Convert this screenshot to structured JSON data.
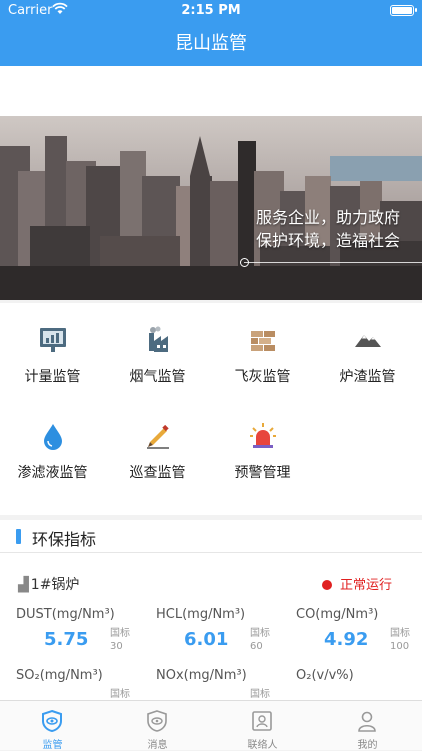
{
  "status_bar": {
    "carrier": "Carrier",
    "time": "2:15 PM"
  },
  "nav": {
    "title": "昆山监管"
  },
  "banner": {
    "slogan_line1": "服务企业，助力政府",
    "slogan_line2": "保护环境，造福社会"
  },
  "menu": [
    {
      "label": "计量监管",
      "icon": "chart-board-icon"
    },
    {
      "label": "烟气监管",
      "icon": "factory-icon"
    },
    {
      "label": "飞灰监管",
      "icon": "bricks-icon"
    },
    {
      "label": "炉渣监管",
      "icon": "mountain-icon"
    },
    {
      "label": "渗滤液监管",
      "icon": "water-drop-icon"
    },
    {
      "label": "巡查监管",
      "icon": "pencil-icon"
    },
    {
      "label": "预警管理",
      "icon": "alarm-light-icon"
    }
  ],
  "env_section": {
    "title": "环保指标",
    "boiler": "1#锅炉",
    "status": "正常运行",
    "metrics": [
      {
        "name": "DUST(mg/Nm³)",
        "value": "5.75",
        "std_label": "国标",
        "std_value": "30"
      },
      {
        "name": "HCL(mg/Nm³)",
        "value": "6.01",
        "std_label": "国标",
        "std_value": "60"
      },
      {
        "name": "CO(mg/Nm³)",
        "value": "4.92",
        "std_label": "国标",
        "std_value": "100"
      },
      {
        "name": "SO₂(mg/Nm³)",
        "value": "",
        "std_label": "国标",
        "std_value": ""
      },
      {
        "name": "NOx(mg/Nm³)",
        "value": "",
        "std_label": "国标",
        "std_value": ""
      },
      {
        "name": "O₂(v/v%)",
        "value": "",
        "std_label": "",
        "std_value": ""
      }
    ]
  },
  "tabs": [
    {
      "label": "监管",
      "icon": "eye-shield-icon",
      "active": true
    },
    {
      "label": "消息",
      "icon": "message-shield-icon",
      "active": false
    },
    {
      "label": "联络人",
      "icon": "contact-card-icon",
      "active": false
    },
    {
      "label": "我的",
      "icon": "person-icon",
      "active": false
    }
  ],
  "colors": {
    "primary": "#3a9cf0",
    "alert": "#e02020"
  }
}
